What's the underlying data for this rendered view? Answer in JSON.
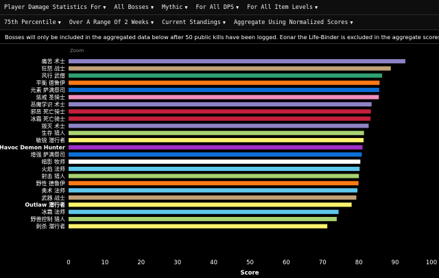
{
  "filters_row1": [
    {
      "label": "Player Damage Statistics For",
      "name": "filter-statistics-type"
    },
    {
      "label": "All Bosses",
      "name": "filter-bosses"
    },
    {
      "label": "Mythic",
      "name": "filter-difficulty"
    },
    {
      "label": "For All DPS",
      "name": "filter-role"
    },
    {
      "label": "For All Item Levels",
      "name": "filter-item-level"
    }
  ],
  "filters_row2": [
    {
      "label": "75th Percentile",
      "name": "filter-percentile"
    },
    {
      "label": "Over A Range Of 2 Weeks",
      "name": "filter-time-range"
    },
    {
      "label": "Current Standings",
      "name": "filter-standings"
    },
    {
      "label": "Aggregate Using Normalized Scores",
      "name": "filter-aggregate"
    }
  ],
  "caret_icon": "caret-down-icon",
  "notice": "Bosses will only be included in the aggregated data below after 50 public kills have been logged. Eonar the Life-Binder is excluded in the aggregate scores below.",
  "chart_data": {
    "type": "bar",
    "orientation": "horizontal",
    "zoom_label": "Zoom",
    "xlabel": "Score",
    "xlim": [
      0,
      100
    ],
    "xticks": [
      0,
      10,
      20,
      30,
      40,
      50,
      60,
      70,
      80,
      90,
      100
    ],
    "grid": false,
    "categories": [
      "痛苦 术士",
      "狂怒 战士",
      "风行 武僧",
      "平衡 德鲁伊",
      "元素 萨满祭司",
      "惩戒 圣骑士",
      "恶魔学识 术士",
      "邪恶 死亡骑士",
      "冰霜 死亡骑士",
      "毁灭 术士",
      "生存 猎人",
      "敏锐 潜行者",
      "Havoc Demon Hunter",
      "增强 萨满祭司",
      "暗影 牧师",
      "火焰 法师",
      "射击 猎人",
      "野性 德鲁伊",
      "奥术 法师",
      "武器 战士",
      "Outlaw 潜行者",
      "冰霜 法师",
      "野兽控制 猎人",
      "刺杀 潜行者"
    ],
    "values": [
      92.8,
      88.8,
      86.4,
      85.7,
      85.6,
      85.5,
      83.5,
      83.3,
      83.2,
      82.7,
      81.4,
      81.3,
      81.0,
      80.8,
      80.4,
      80.2,
      80.0,
      79.9,
      79.6,
      79.3,
      78.0,
      74.4,
      73.9,
      71.3
    ],
    "colors": [
      "#8e83c6",
      "#c2a176",
      "#2ea070",
      "#ff7a14",
      "#0d6fd6",
      "#f28fbe",
      "#8e83c6",
      "#c41f3b",
      "#c41f3b",
      "#8e83c6",
      "#a9d271",
      "#fff36c",
      "#a330c9",
      "#0d6fd6",
      "#ffffff",
      "#5fc7ec",
      "#a9d271",
      "#ff7a14",
      "#5fc7ec",
      "#c2a176",
      "#fff36c",
      "#5fc7ec",
      "#a9d271",
      "#fff36c"
    ]
  }
}
